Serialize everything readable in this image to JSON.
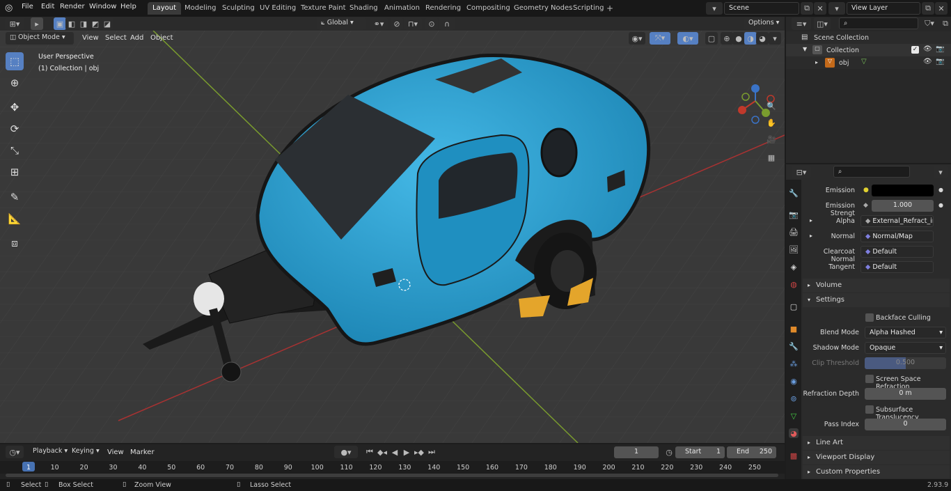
{
  "menus": [
    "File",
    "Edit",
    "Render",
    "Window",
    "Help"
  ],
  "workspaces": [
    "Layout",
    "Modeling",
    "Sculpting",
    "UV Editing",
    "Texture Paint",
    "Shading",
    "Animation",
    "Rendering",
    "Compositing",
    "Geometry Nodes",
    "Scripting"
  ],
  "scene": "Scene",
  "view_layer": "View Layer",
  "viewport": {
    "mode": "Object Mode",
    "menus": [
      "View",
      "Select",
      "Add",
      "Object"
    ],
    "orientation": "Global",
    "options": "Options",
    "overlay_title": "User Perspective",
    "overlay_sub": "(1) Collection | obj",
    "gizmo": {
      "z": "Z",
      "y": "Y",
      "x": "X"
    }
  },
  "outliner": {
    "root": "Scene Collection",
    "collection": "Collection",
    "object": "obj"
  },
  "properties": {
    "emission_label": "Emission",
    "emission_strength_label": "Emission Strengt",
    "emission_strength_value": "1.000",
    "alpha_label": "Alpha",
    "alpha_value": "External_Refract_in...",
    "normal_label": "Normal",
    "normal_value": "Normal/Map",
    "clearcoat_label": "Clearcoat Normal",
    "clearcoat_value": "Default",
    "tangent_label": "Tangent",
    "tangent_value": "Default",
    "volume": "Volume",
    "settings": "Settings",
    "backface": "Backface Culling",
    "blend_label": "Blend Mode",
    "blend_value": "Alpha Hashed",
    "shadow_label": "Shadow Mode",
    "shadow_value": "Opaque",
    "clip_label": "Clip Threshold",
    "clip_value": "0.500",
    "ssr": "Screen Space Refraction",
    "refr_label": "Refraction Depth",
    "refr_value": "0 m",
    "sss": "Subsurface Translucency",
    "pass_label": "Pass Index",
    "pass_value": "0",
    "line_art": "Line Art",
    "viewport_display": "Viewport Display",
    "custom_props": "Custom Properties"
  },
  "timeline": {
    "menus": [
      "Playback",
      "Keying",
      "View",
      "Marker"
    ],
    "current_frame": "1",
    "start_label": "Start",
    "start_value": "1",
    "end_label": "End",
    "end_value": "250",
    "ticks": [
      "1",
      "10",
      "20",
      "30",
      "40",
      "50",
      "60",
      "70",
      "80",
      "90",
      "100",
      "110",
      "120",
      "130",
      "140",
      "150",
      "160",
      "170",
      "180",
      "190",
      "200",
      "210",
      "220",
      "230",
      "240",
      "250"
    ]
  },
  "status": {
    "select": "Select",
    "box_select": "Box Select",
    "zoom": "Zoom View",
    "lasso": "Lasso Select",
    "version": "2.93.9"
  },
  "colors": {
    "accent": "#5680c2",
    "trailer": "#2ea6d6",
    "x_axis": "#c0392b",
    "y_axis": "#7a9c2e"
  }
}
